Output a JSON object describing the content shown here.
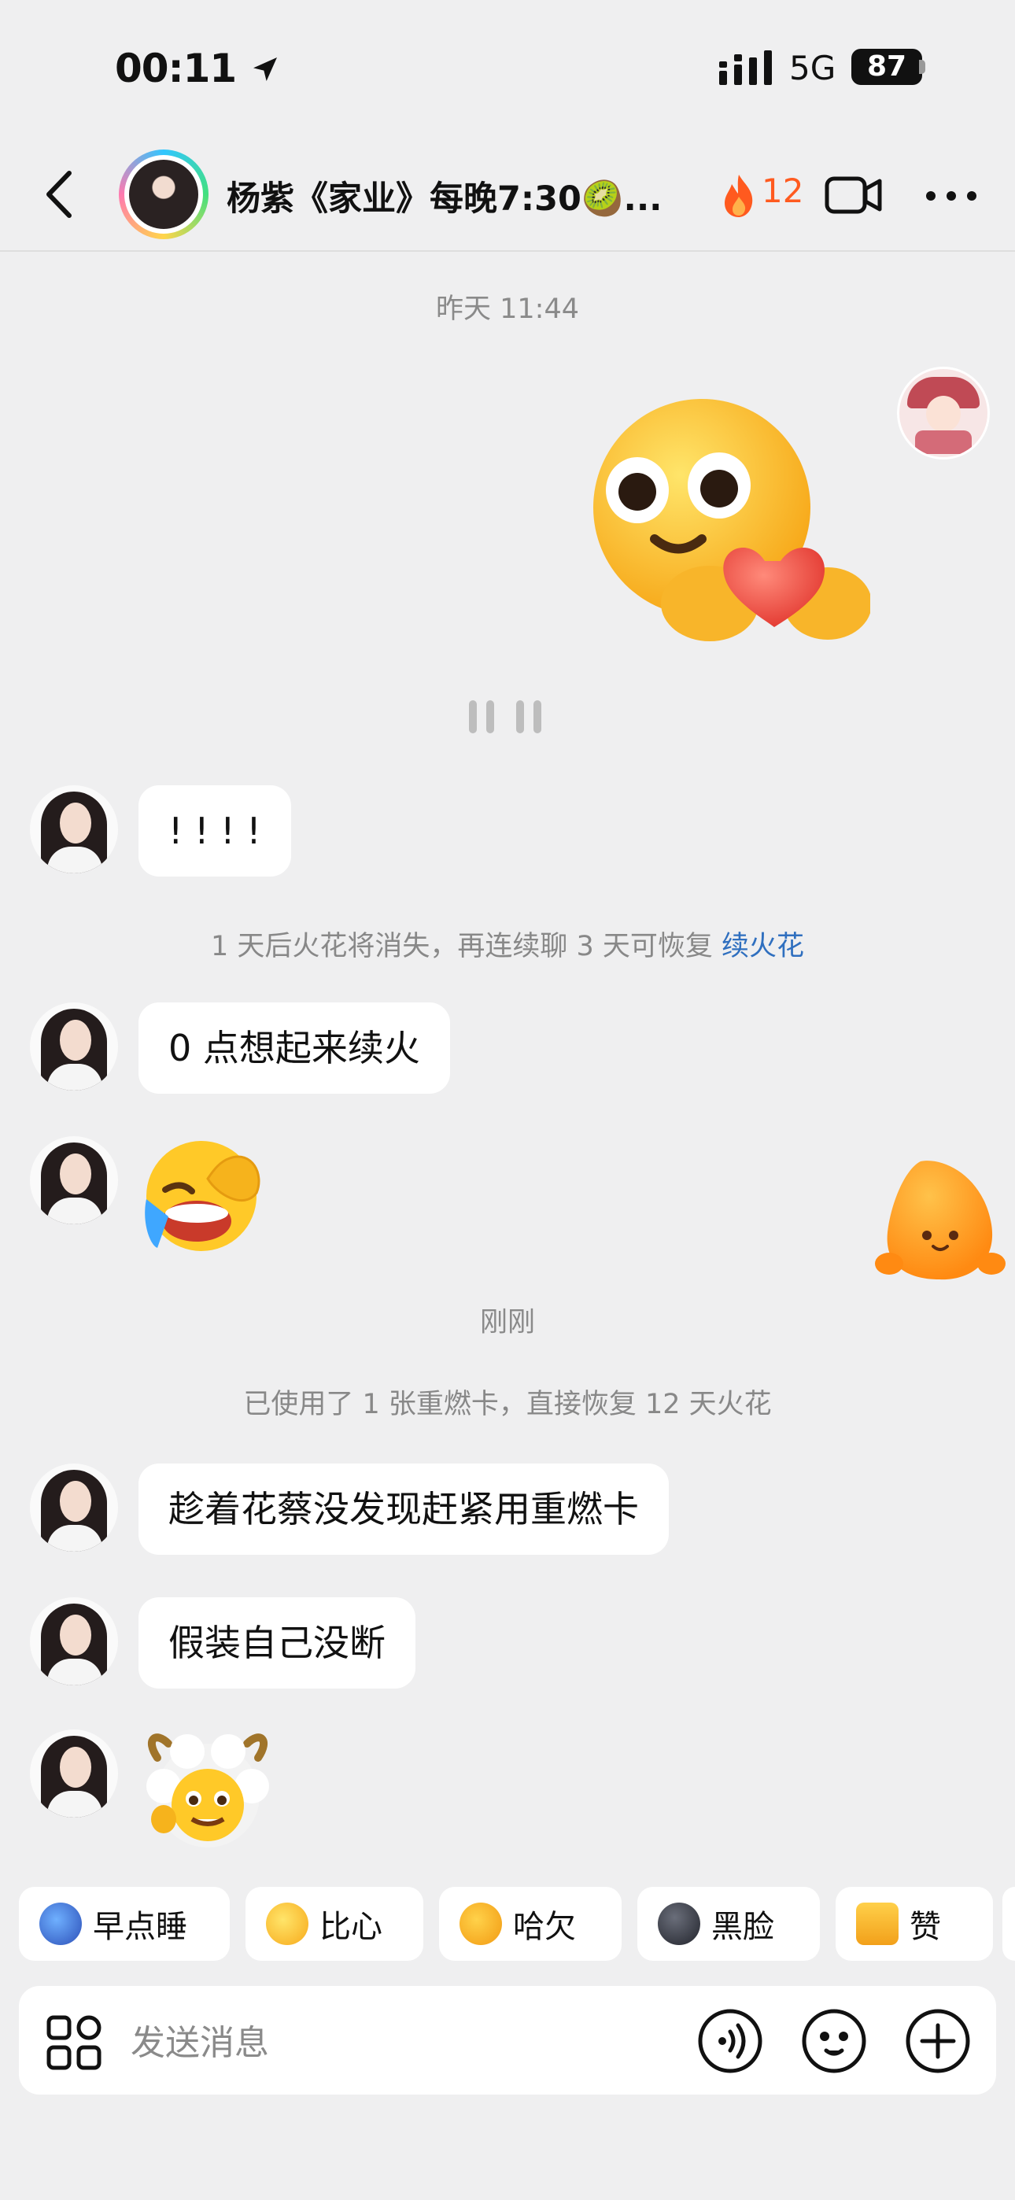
{
  "status_bar": {
    "time": "00:11",
    "network": "5G",
    "battery": "87"
  },
  "header": {
    "title": "杨紫《家业》每晚7:30🥝...",
    "streak_count": "12"
  },
  "messages": {
    "timestamp_1": "昨天 11:44",
    "msg_exclaim": "! ! ! !",
    "system_1_text": "1 天后火花将消失，再连续聊 3 天可恢复 ",
    "system_1_link": "续火花",
    "msg_continue": "0 点想起来续火",
    "timestamp_2": "刚刚",
    "system_2_text": "已使用了 1 张重燃卡，直接恢复 12 天火花",
    "msg_sneak": "趁着花蔡没发现赶紧用重燃卡",
    "msg_pretend": "假装自己没断"
  },
  "quick_replies": [
    {
      "label": "早点睡",
      "icon": "sleep-icon"
    },
    {
      "label": "比心",
      "icon": "heart-hands-icon"
    },
    {
      "label": "哈欠",
      "icon": "yawn-icon"
    },
    {
      "label": "黑脸",
      "icon": "dark-face-icon"
    },
    {
      "label": "赞",
      "icon": "thumbs-up-icon"
    }
  ],
  "composer": {
    "placeholder": "发送消息"
  },
  "colors": {
    "link": "#2f6fbf",
    "streak": "#ff5a1f",
    "background": "#efeff0"
  }
}
